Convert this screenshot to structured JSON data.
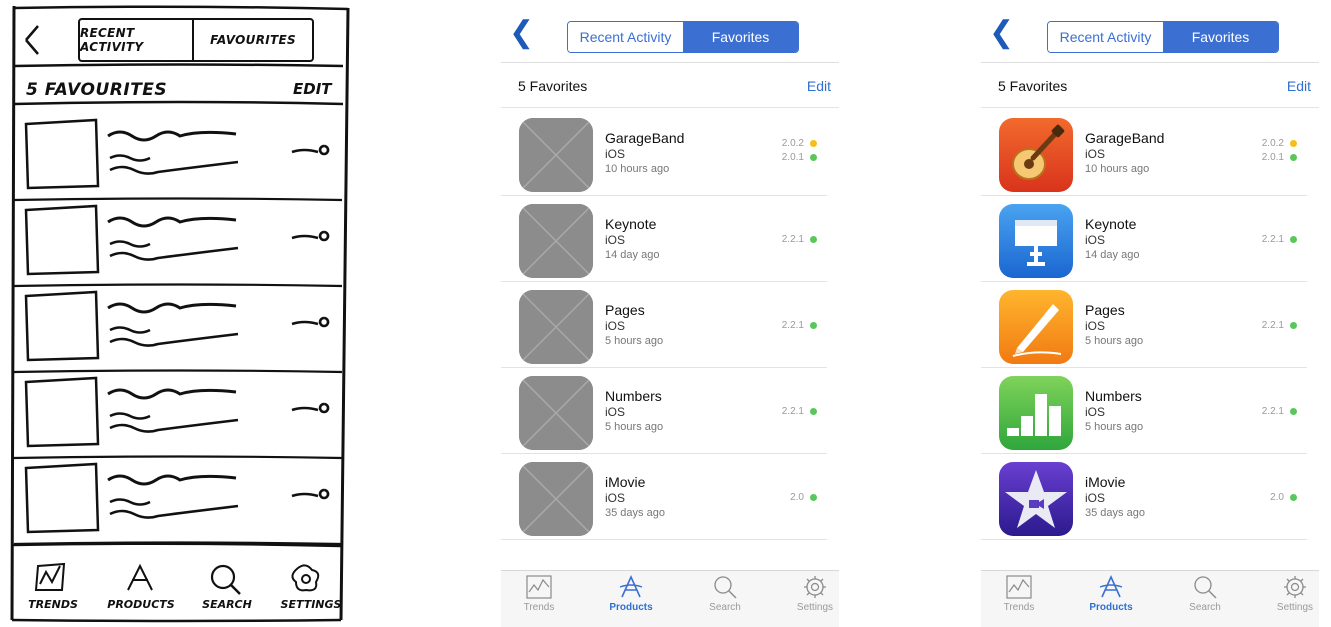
{
  "colors": {
    "accent": "#3b6fd1",
    "placeholder": "#8c8c8c",
    "status_yellow": "#f5be1c",
    "status_green": "#5cc55c"
  },
  "sketch": {
    "segment": [
      "RECENT ACTIVITY",
      "FAVOURITES"
    ],
    "title": "5 FAVOURITES",
    "edit": "EDIT",
    "tabs": [
      "TRENDS",
      "PRODUCTS",
      "SEARCH",
      "SETTINGS"
    ]
  },
  "wireframe": {
    "segment": [
      "Recent Activity",
      "Favorites"
    ],
    "title": "5 Favorites",
    "edit": "Edit",
    "items": [
      {
        "name": "GarageBand",
        "platform": "iOS",
        "time": "10 hours ago",
        "versions": [
          {
            "v": "2.0.2",
            "status": "yellow"
          },
          {
            "v": "2.0.1",
            "status": "green"
          }
        ]
      },
      {
        "name": "Keynote",
        "platform": "iOS",
        "time": "14 day ago",
        "versions": [
          {
            "v": "2.2.1",
            "status": "green"
          }
        ]
      },
      {
        "name": "Pages",
        "platform": "iOS",
        "time": "5 hours ago",
        "versions": [
          {
            "v": "2.2.1",
            "status": "green"
          }
        ]
      },
      {
        "name": "Numbers",
        "platform": "iOS",
        "time": "5 hours ago",
        "versions": [
          {
            "v": "2.2.1",
            "status": "green"
          }
        ]
      },
      {
        "name": "iMovie",
        "platform": "iOS",
        "time": "35 days ago",
        "versions": [
          {
            "v": "2.0",
            "status": "green"
          }
        ]
      }
    ],
    "tabs": [
      "Trends",
      "Products",
      "Search",
      "Settings"
    ],
    "active_tab": "Products"
  },
  "final": {
    "segment": [
      "Recent Activity",
      "Favorites"
    ],
    "title": "5 Favorites",
    "edit": "Edit",
    "items": [
      {
        "name": "GarageBand",
        "platform": "iOS",
        "time": "10 hours ago",
        "icon": "garageband-icon",
        "versions": [
          {
            "v": "2.0.2",
            "status": "yellow"
          },
          {
            "v": "2.0.1",
            "status": "green"
          }
        ]
      },
      {
        "name": "Keynote",
        "platform": "iOS",
        "time": "14 day ago",
        "icon": "keynote-icon",
        "versions": [
          {
            "v": "2.2.1",
            "status": "green"
          }
        ]
      },
      {
        "name": "Pages",
        "platform": "iOS",
        "time": "5 hours ago",
        "icon": "pages-icon",
        "versions": [
          {
            "v": "2.2.1",
            "status": "green"
          }
        ]
      },
      {
        "name": "Numbers",
        "platform": "iOS",
        "time": "5 hours ago",
        "icon": "numbers-icon",
        "versions": [
          {
            "v": "2.2.1",
            "status": "green"
          }
        ]
      },
      {
        "name": "iMovie",
        "platform": "iOS",
        "time": "35 days ago",
        "icon": "imovie-icon",
        "versions": [
          {
            "v": "2.0",
            "status": "green"
          }
        ]
      }
    ],
    "tabs": [
      "Trends",
      "Products",
      "Search",
      "Settings"
    ],
    "active_tab": "Products"
  }
}
